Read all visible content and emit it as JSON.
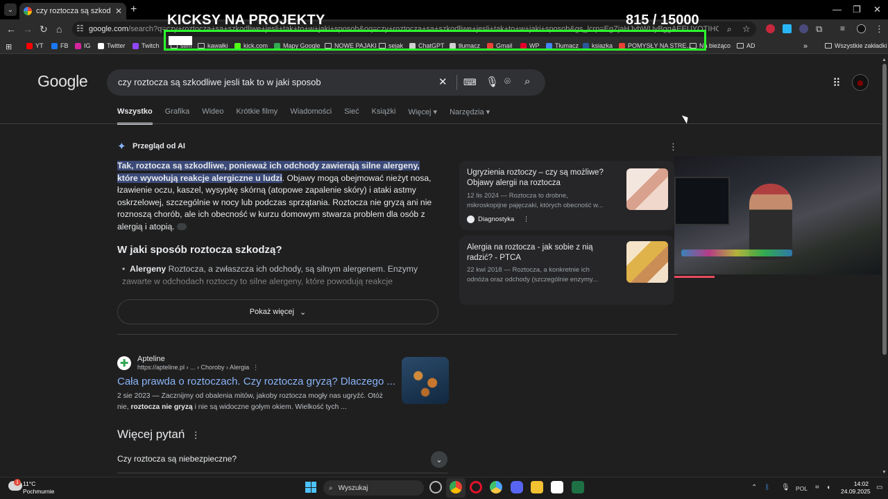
{
  "browser": {
    "tab_title": "czy roztocza są szkodliwe jesli t",
    "url_host": "google.com",
    "url_rest": "/search?q=czy+roztocza+sa+szkodliwe+jesli+tak+to+w+jaki+sposob&oq=czy+roztocza+sa+szkodliwe+jesli+tak+to+w+jaki+sposob&gs_lcrp=EgZjaHJvbWUyBggAEEUYOTIHCAEQIRigATIHCAIQIRigATIHCA",
    "bookmarks": [
      {
        "label": "YT",
        "color": "#ff0000"
      },
      {
        "label": "FB",
        "color": "#1877f2"
      },
      {
        "label": "IG",
        "color": "#d6249f"
      },
      {
        "label": "Twitter",
        "color": "#ffffff"
      },
      {
        "label": "Twitch",
        "color": "#9146ff"
      },
      {
        "label": "stim",
        "color": "#cfcfcf"
      },
      {
        "label": "kawałki",
        "color": "#cfcfcf"
      },
      {
        "label": "kick.com",
        "color": "#53fc18"
      },
      {
        "label": "Mapy Google",
        "color": "#34a853"
      },
      {
        "label": "NOWE PAJAKI",
        "color": "#cfcfcf"
      },
      {
        "label": "sejak",
        "color": "#cfcfcf"
      },
      {
        "label": "ChatGPT",
        "color": "#cfcfcf"
      },
      {
        "label": "tłumacz",
        "color": "#cfcfcf"
      },
      {
        "label": "Gmail",
        "color": "#ea4335"
      },
      {
        "label": "WP",
        "color": "#e4002b"
      },
      {
        "label": "Tłumacz",
        "color": "#4285f4"
      },
      {
        "label": "ksiazka",
        "color": "#2b579a"
      },
      {
        "label": "POMYSŁY NA STRE...",
        "color": "#ea4335"
      },
      {
        "label": "Na bieżąco",
        "color": "#cfcfcf"
      },
      {
        "label": "AD",
        "color": "#cfcfcf"
      }
    ],
    "all_bookmarks": "Wszystkie zakładki"
  },
  "overlay": {
    "title": "KICKSY NA PROJEKTY",
    "count": "815   / 15000"
  },
  "google": {
    "logo": "Google",
    "query": "czy roztocza są szkodliwe jesli tak to w jaki sposob",
    "tabs": [
      "Wszystko",
      "Grafika",
      "Wideo",
      "Krótkie filmy",
      "Wiadomości",
      "Sieć",
      "Książki",
      "Więcej",
      "Narzędzia"
    ],
    "ai": {
      "title": "Przegląd od AI",
      "highlight": "Tak, roztocza są szkodliwe, ponieważ ich odchody zawierają silne alergeny, które wywołują reakcje alergiczne u ludzi",
      "body": ". Objawy mogą obejmować nieżyt nosa, łzawienie oczu, kaszel, wysypkę skórną (atopowe zapalenie skóry) i ataki astmy oskrzelowej, szczególnie w nocy lub podczas sprzątania. Roztocza nie gryzą ani nie roznoszą chorób, ale ich obecność w kurzu domowym stwarza problem dla osób z alergią i atopią.",
      "h2": "W jaki sposób roztocza szkodzą?",
      "bullet_bold": "Alergeny",
      "bullet_text": " Roztocza, a zwłaszcza ich odchody, są silnym alergenem. Enzymy zawarte w odchodach roztoczy to silne alergeny, które powodują reakcje",
      "show_more": "Pokaż więcej"
    },
    "sources": [
      {
        "title": "Ugryzienia roztoczy – czy są możliwe? Objawy alergii na roztocza",
        "meta1": "12 lis 2024 — Roztocza to drobne,",
        "meta2": "mikroskopijne pajęczaki, których obecność w...",
        "site": "Diagnostyka"
      },
      {
        "title": "Alergia na roztocza - jak sobie z nią radzić? - PTCA",
        "meta1": "22 kwi 2018 — Roztocza, a konkretnie ich",
        "meta2": "odnóża oraz odchody (szczególnie enzymy..."
      }
    ],
    "result": {
      "site": "Apteline",
      "url": "https://apteline.pl › ... › Choroby › Alergia",
      "title": "Cała prawda o roztoczach. Czy roztocza gryzą? Dlaczego ...",
      "snippet_start": "2 sie 2023 — Zacznijmy od obalenia mitów, jakoby roztocza mogły nas ugryźć. Otóż nie, ",
      "snippet_bold": "roztocza nie gryzą",
      "snippet_end": " i nie są widoczne gołym okiem. Wielkość tych ..."
    },
    "paa": {
      "title": "Więcej pytań",
      "q1": "Czy roztocza są niebezpieczne?"
    }
  },
  "taskbar": {
    "temp": "11°C",
    "condition": "Pochmurnie",
    "search": "Wyszukaj",
    "lang": "POL",
    "time": "14:02",
    "date": "24.09.2025",
    "weather_badge": "1"
  }
}
